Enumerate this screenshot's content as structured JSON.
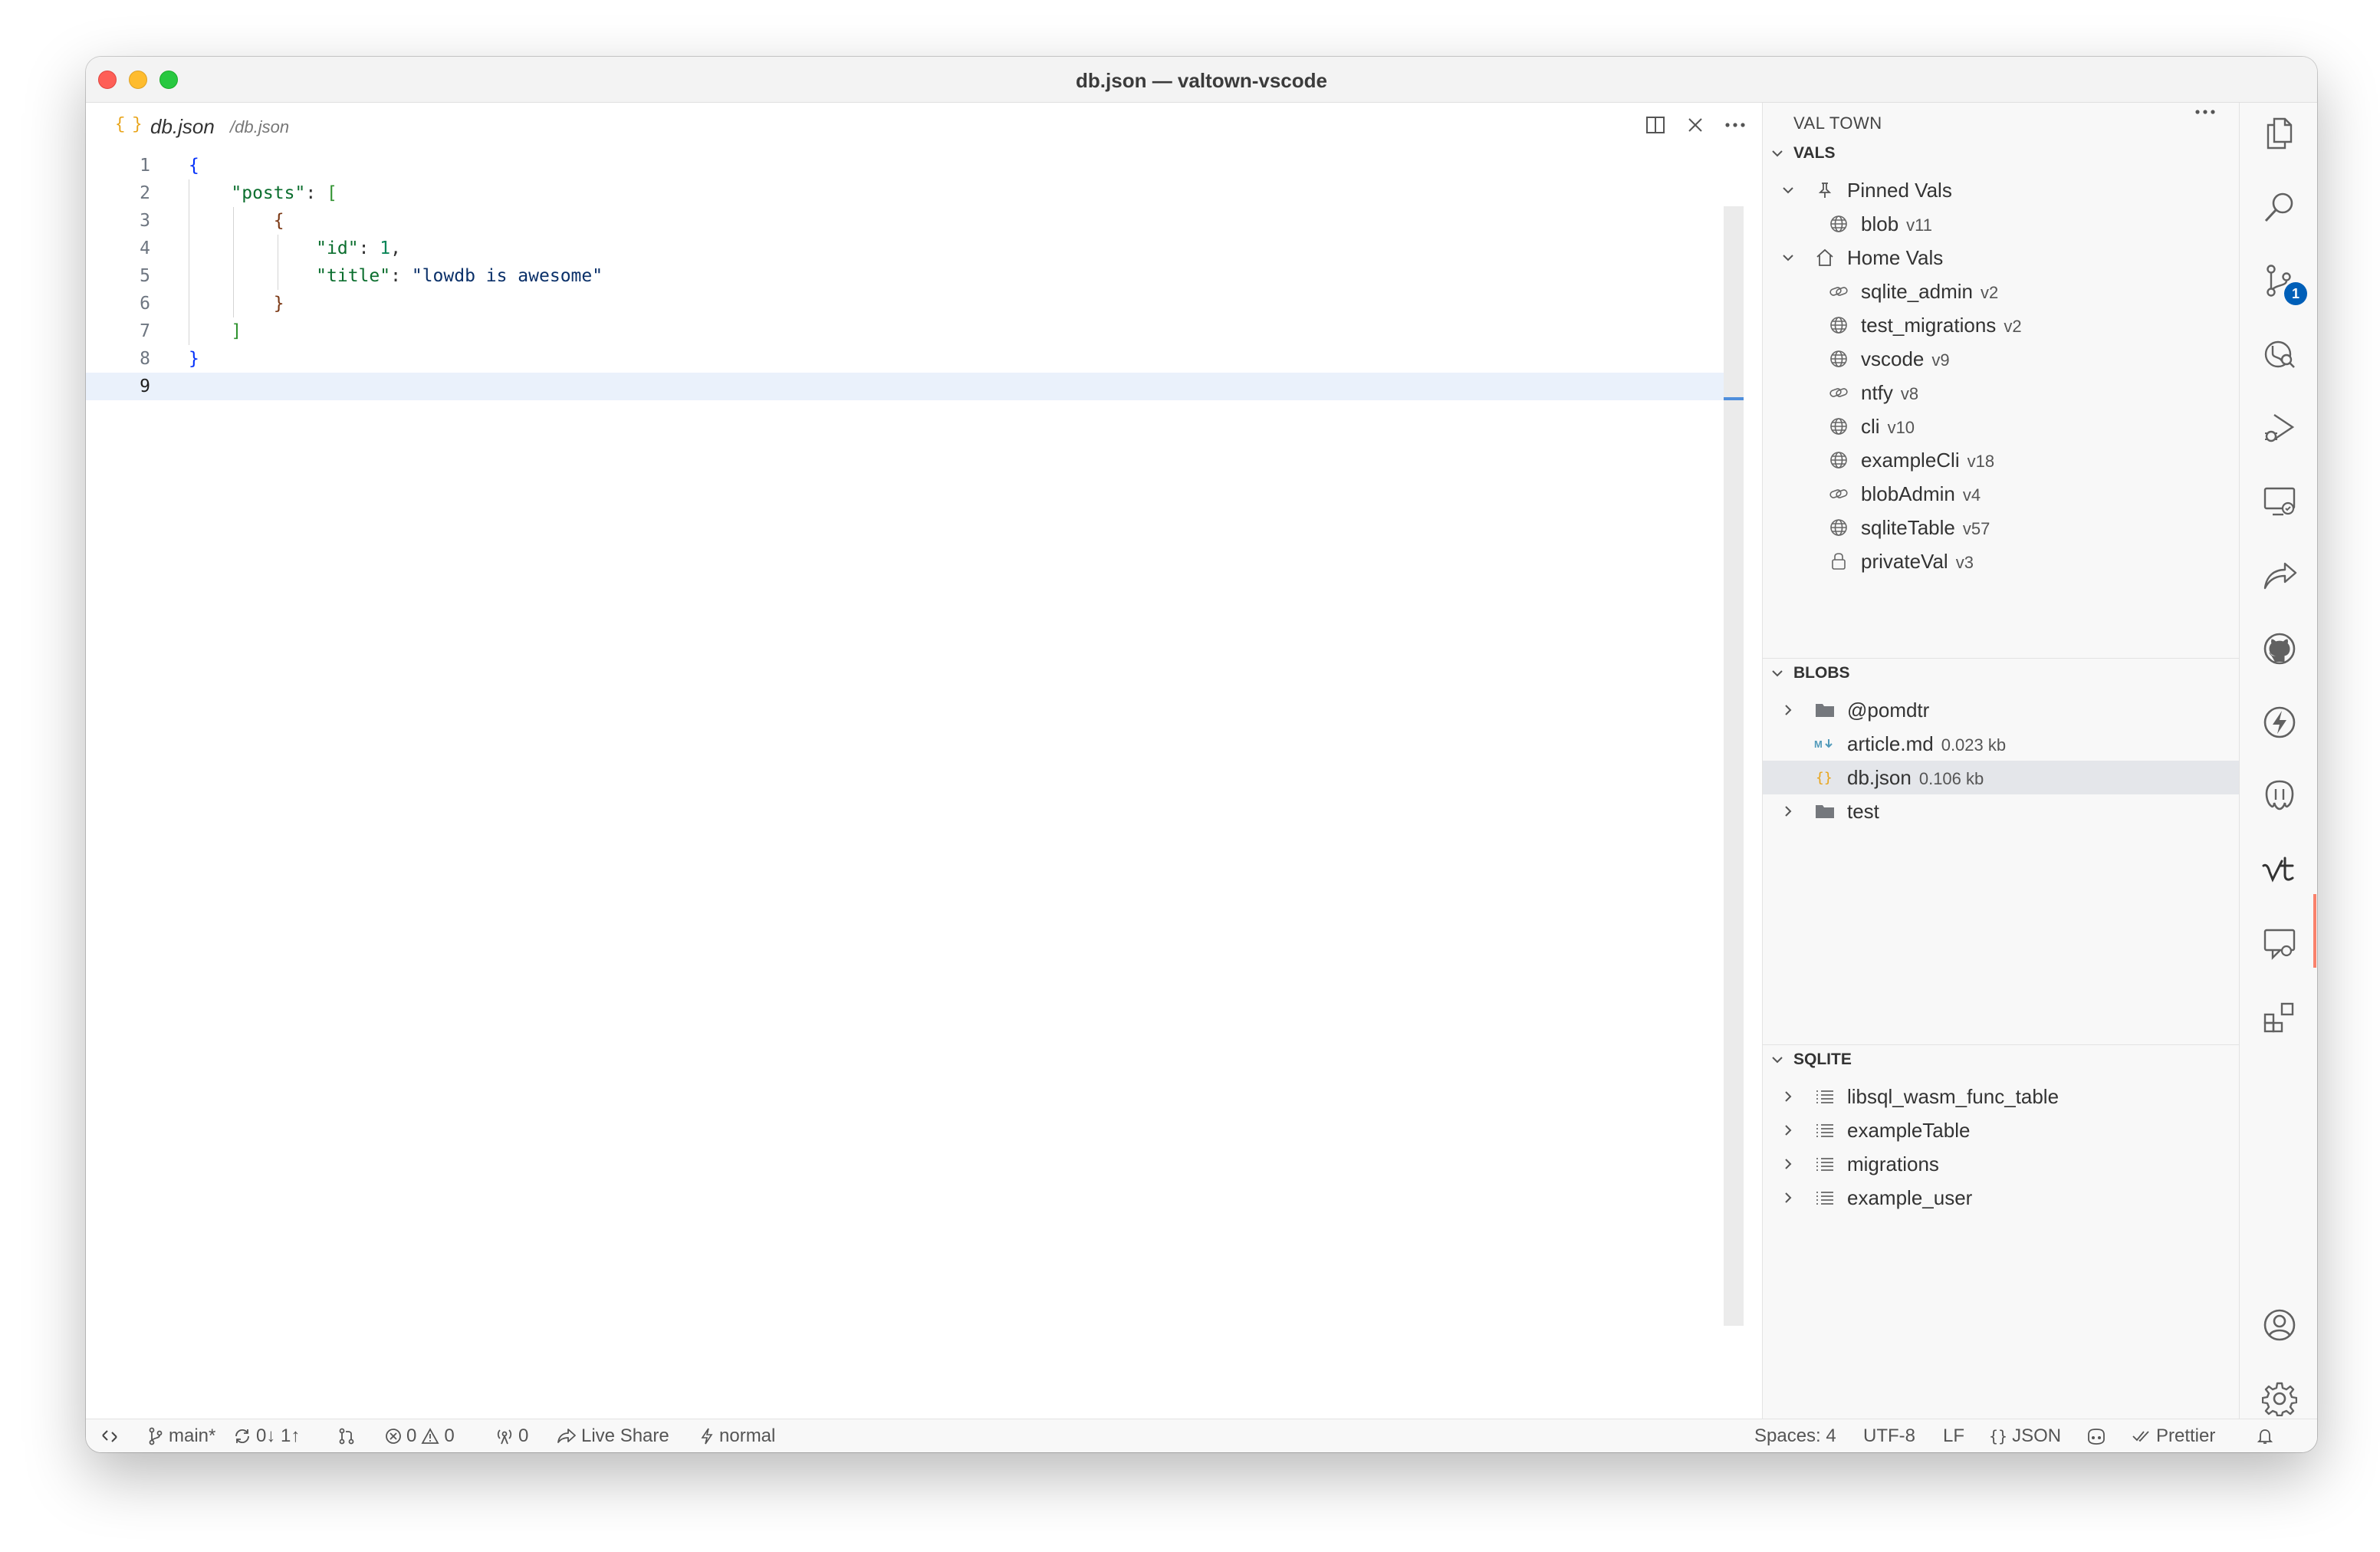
{
  "window": {
    "title": "db.json — valtown-vscode"
  },
  "editor": {
    "tab": {
      "icon": "{ }",
      "name": "db.json",
      "path": "/db.json"
    },
    "lines": [
      {
        "no": "1",
        "text": "{"
      },
      {
        "no": "2",
        "text": "    \"posts\": ["
      },
      {
        "no": "3",
        "text": "        {"
      },
      {
        "no": "4",
        "text": "            \"id\": 1,"
      },
      {
        "no": "5",
        "text": "            \"title\": \"lowdb is awesome\""
      },
      {
        "no": "6",
        "text": "        }"
      },
      {
        "no": "7",
        "text": "    ]"
      },
      {
        "no": "8",
        "text": "}"
      },
      {
        "no": "9",
        "text": ""
      }
    ]
  },
  "sidebar": {
    "title": "VAL TOWN",
    "vals": {
      "label": "VALS",
      "pinned": {
        "label": "Pinned Vals",
        "items": [
          {
            "name": "blob",
            "version": "v11",
            "icon": "globe-icon"
          }
        ]
      },
      "home": {
        "label": "Home Vals",
        "items": [
          {
            "name": "sqlite_admin",
            "version": "v2",
            "icon": "link-icon"
          },
          {
            "name": "test_migrations",
            "version": "v2",
            "icon": "globe-icon"
          },
          {
            "name": "vscode",
            "version": "v9",
            "icon": "globe-icon"
          },
          {
            "name": "ntfy",
            "version": "v8",
            "icon": "link-icon"
          },
          {
            "name": "cli",
            "version": "v10",
            "icon": "globe-icon"
          },
          {
            "name": "exampleCli",
            "version": "v18",
            "icon": "globe-icon"
          },
          {
            "name": "blobAdmin",
            "version": "v4",
            "icon": "link-icon"
          },
          {
            "name": "sqliteTable",
            "version": "v57",
            "icon": "globe-icon"
          },
          {
            "name": "privateVal",
            "version": "v3",
            "icon": "lock-icon"
          }
        ]
      }
    },
    "blobs": {
      "label": "BLOBS",
      "items": [
        {
          "name": "@pomdtr",
          "meta": ""
        },
        {
          "name": "article.md",
          "meta": "0.023 kb"
        },
        {
          "name": "db.json",
          "meta": "0.106 kb"
        },
        {
          "name": "test",
          "meta": ""
        }
      ]
    },
    "sqlite": {
      "label": "SQLITE",
      "items": [
        "libsql_wasm_func_table",
        "exampleTable",
        "migrations",
        "example_user"
      ]
    }
  },
  "activity": {
    "source_control_badge": "1"
  },
  "statusbar": {
    "branch": "main*",
    "sync": "0↓ 1↑",
    "errors": "0",
    "warnings": "0",
    "ports": "0",
    "live_share": "Live Share",
    "mode": "normal",
    "spaces": "Spaces: 4",
    "encoding": "UTF-8",
    "eol": "LF",
    "language": "JSON",
    "prettier": "Prettier"
  },
  "colors": {
    "json_key": "#0b6e2e",
    "json_bracket_1": "#0431fa",
    "json_bracket_2": "#319331",
    "json_bracket_3": "#7b3814",
    "json_number": "#098658",
    "json_string": "#0a3069",
    "activity_indicator": "#f9826c",
    "badge": "#005fb8"
  }
}
